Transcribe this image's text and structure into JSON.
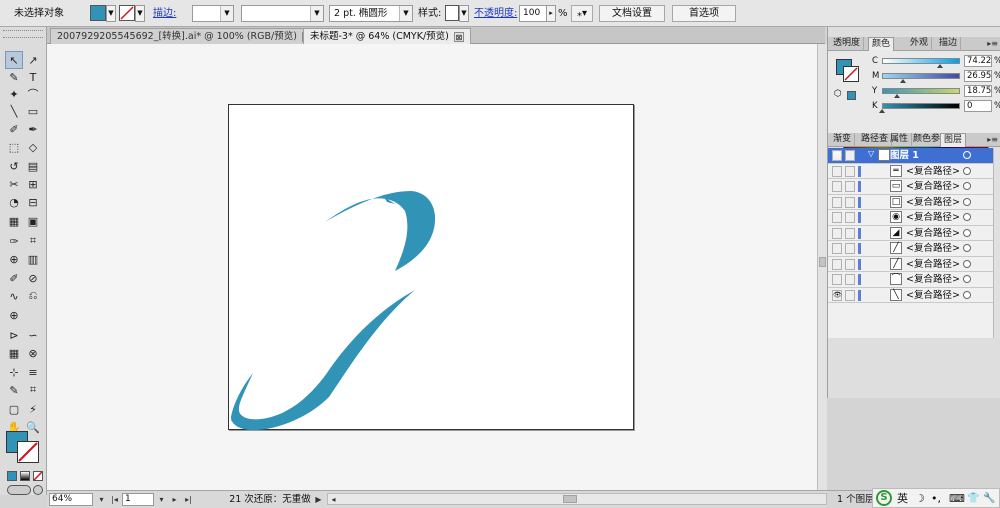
{
  "control_bar": {
    "selection_label": "未选择对象",
    "stroke_link": "描边:",
    "stroke_weight_value": "",
    "stroke_profile_value": "",
    "brush_value": "2 pt. 椭圆形",
    "style_label": "样式:",
    "opacity_link": "不透明度:",
    "opacity_value": "100",
    "opacity_unit": "%",
    "doc_setup_button": "文档设置",
    "preferences_button": "首选项",
    "colors": {
      "fill": "#3193b5"
    }
  },
  "tabs": [
    {
      "label": "2007929205545692_[转换].ai* @ 100% (RGB/预览)",
      "close": "⊠",
      "active": false
    },
    {
      "label": "未标题-3* @ 64% (CMYK/预览)",
      "close": "⊠",
      "active": true
    }
  ],
  "tools": {
    "icons": [
      "↖",
      "↗",
      "✎",
      "T",
      "✦",
      "⌒",
      "╲",
      "▭",
      "✐",
      "✒",
      "⬚",
      "◇",
      "↺",
      "▤",
      "✂",
      "⊞",
      "◔",
      "⊟",
      "▦",
      "▣",
      "✑",
      "⌗",
      "⊕",
      "▥",
      "✐",
      "⊘",
      "∿",
      "⎌",
      "⊕",
      "",
      "⊳",
      "∽",
      "▦",
      "⊗",
      "⊹",
      "≡",
      "✎",
      "⌗",
      "▢",
      "⚡",
      "✋",
      "🔍"
    ]
  },
  "status_bar": {
    "zoom": "64%",
    "page": "1",
    "history": "21 次还原：无重做",
    "prev_first": "|◂",
    "prev": "◂",
    "next": "▸",
    "next_last": "▸|",
    "play": "▶"
  },
  "color_panel": {
    "tabs": [
      "透明度",
      "颜色",
      "外观",
      "描边"
    ],
    "active_tab": "颜色",
    "channels": [
      {
        "letter": "C",
        "value": "74.22",
        "unit": "%",
        "fraction": 0.7422
      },
      {
        "letter": "M",
        "value": "26.95",
        "unit": "%",
        "fraction": 0.2695
      },
      {
        "letter": "Y",
        "value": "18.75",
        "unit": "%",
        "fraction": 0.1875
      },
      {
        "letter": "K",
        "value": "0",
        "unit": "%",
        "fraction": 0
      }
    ]
  },
  "layers_panel": {
    "tabs": [
      "渐变",
      "路径查",
      "属性",
      "颜色参",
      "图层"
    ],
    "active_tab": "图层",
    "top_layer": "图层 1",
    "items": [
      {
        "name": "<复合路径>"
      },
      {
        "name": "<复合路径>"
      },
      {
        "name": "<复合路径>"
      },
      {
        "name": "<复合路径>"
      },
      {
        "name": "<复合路径>"
      },
      {
        "name": "<复合路径>"
      },
      {
        "name": "<复合路径>"
      },
      {
        "name": "<复合路径>"
      },
      {
        "name": "<复合路径>"
      }
    ],
    "footer": "1 个图层"
  },
  "tray": {
    "ime_icon": "S",
    "lang": "英",
    "moon": "☽",
    "punct": "•,",
    "keyboard": "⌨",
    "shirt": "👕",
    "wrench": "🔧"
  }
}
